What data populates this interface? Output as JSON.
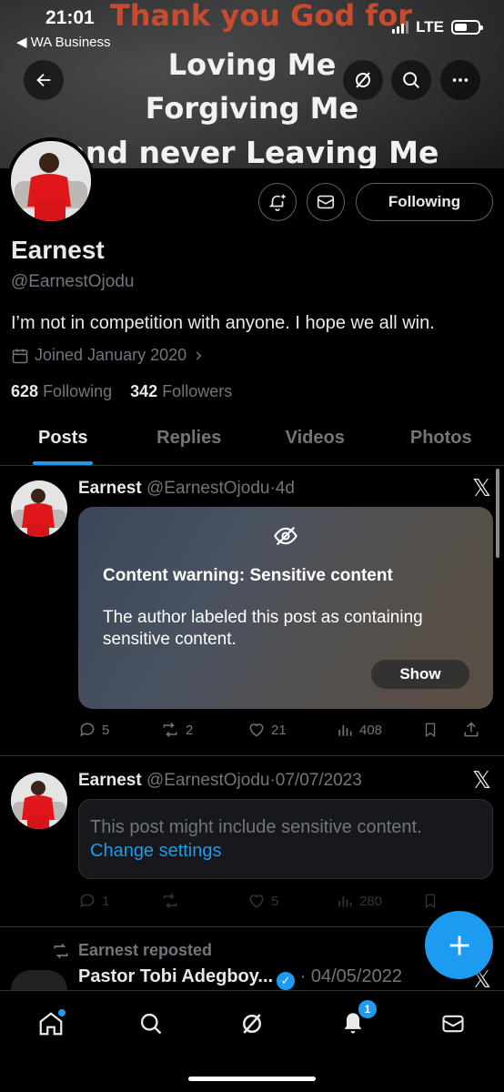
{
  "status_bar": {
    "time": "21:01",
    "back_app": "◀ WA Business",
    "network": "LTE"
  },
  "banner": {
    "line1": "Thank you God for",
    "line2": "Loving Me",
    "line3": "Forgiving Me",
    "line4": "and never Leaving Me"
  },
  "profile": {
    "name": "Earnest",
    "handle": "@EarnestOjodu",
    "bio": "I’m not in competition with anyone. I hope we all win.",
    "joined": "Joined January 2020",
    "following_count": "628",
    "following_label": "Following",
    "followers_count": "342",
    "followers_label": "Followers",
    "follow_button": "Following"
  },
  "tabs": [
    {
      "label": "Posts",
      "active": true
    },
    {
      "label": "Replies",
      "active": false
    },
    {
      "label": "Videos",
      "active": false
    },
    {
      "label": "Photos",
      "active": false
    }
  ],
  "posts": [
    {
      "name": "Earnest",
      "handle": "@EarnestOjodu",
      "time": "4d",
      "warning_title": "Content warning: Sensitive content",
      "warning_text": "The author labeled this post as containing sensitive content.",
      "show_label": "Show",
      "replies": "5",
      "reposts": "2",
      "likes": "21",
      "views": "408"
    },
    {
      "name": "Earnest",
      "handle": "@EarnestOjodu",
      "time": "07/07/2023",
      "notice_text": "This post might include sensitive content.",
      "notice_link": "Change settings",
      "replies": "1",
      "reposts": "",
      "likes": "5",
      "views": "280"
    },
    {
      "repost_label": "Earnest reposted",
      "name": "Pastor Tobi Adegboy...",
      "time": "04/05/2022"
    }
  ],
  "nav": {
    "notifications_badge": "1"
  },
  "colors": {
    "accent": "#1d9bf0",
    "muted": "#71767b",
    "text": "#e7e9ea",
    "border": "#2f3336"
  }
}
